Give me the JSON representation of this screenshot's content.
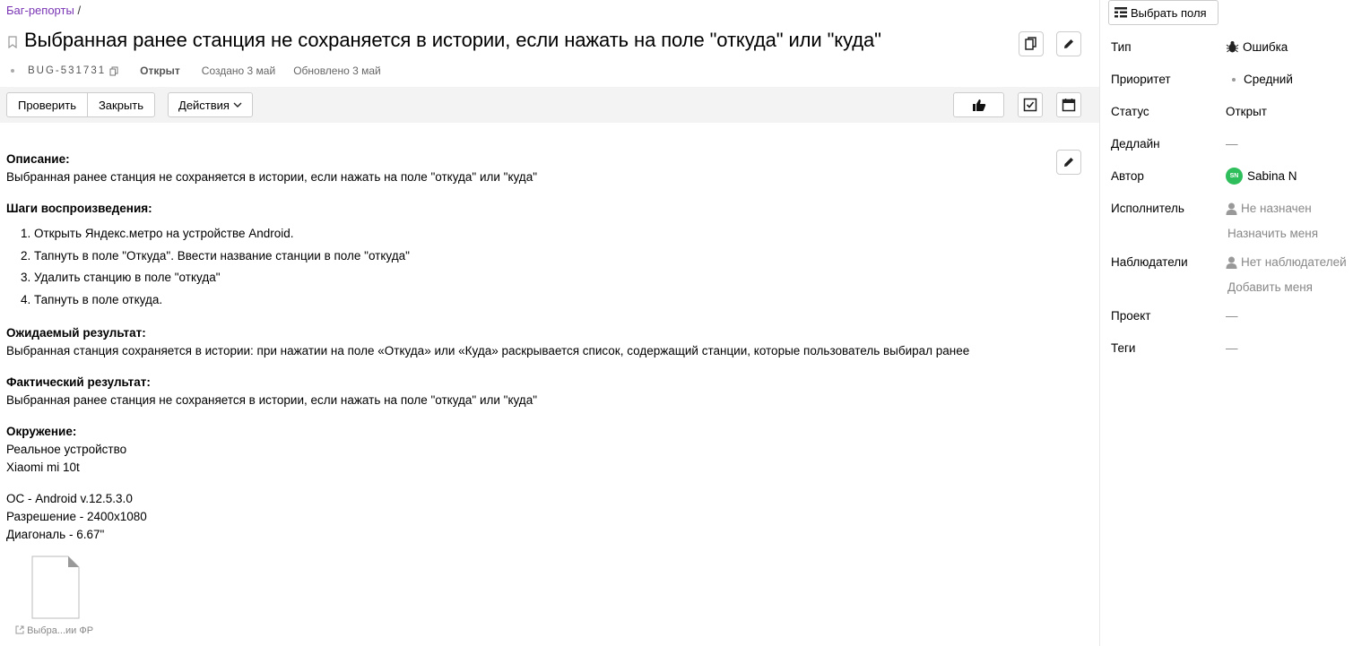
{
  "breadcrumb": {
    "link": "Баг-репорты",
    "sep": "/"
  },
  "issue": {
    "title": "Выбранная ранее станция не сохраняется в истории, если нажать на поле \"откуда\" или \"куда\"",
    "key": "BUG-531731",
    "status": "Открыт",
    "created": "Создано 3 май",
    "updated": "Обновлено 3 май"
  },
  "toolbar": {
    "check_label": "Проверить",
    "close_label": "Закрыть",
    "actions_label": "Действия"
  },
  "description": {
    "desc_heading": "Описание:",
    "desc_text": "Выбранная ранее станция не сохраняется в истории, если нажать на поле \"откуда\" или \"куда\"",
    "steps_heading": "Шаги воспроизведения:",
    "steps": [
      "Открыть Яндекс.метро на устройстве Android.",
      "Тапнуть в поле \"Откуда\". Ввести название станции в поле \"откуда\"",
      "Удалить станцию в поле \"откуда\"",
      "Тапнуть в поле откуда."
    ],
    "expected_heading": "Ожидаемый результат:",
    "expected_text": "Выбранная станция сохраняется в истории: при нажатии на поле «Откуда» или «Куда» раскрывается список, содержащий станции, которые пользователь выбирал ранее",
    "actual_heading": "Фактический результат:",
    "actual_text": "Выбранная ранее станция не сохраняется в истории, если нажать на поле \"откуда\" или \"куда\"",
    "env_heading": "Окружение:",
    "env_lines": [
      "Реальное устройство",
      "Xiaomi mi 10t"
    ],
    "os_lines": [
      "ОС - Android v.12.5.3.0",
      "Разрешение - 2400x1080",
      "Диагональ - 6.67\""
    ]
  },
  "attachment": {
    "label": "Выбра...ии ФР"
  },
  "sidebar": {
    "select_fields_label": "Выбрать поля",
    "fields": {
      "type_label": "Тип",
      "type_value": "Ошибка",
      "priority_label": "Приоритет",
      "priority_value": "Средний",
      "status_label": "Статус",
      "status_value": "Открыт",
      "deadline_label": "Дедлайн",
      "deadline_value": "—",
      "author_label": "Автор",
      "author_initials": "SN",
      "author_value": "Sabina N",
      "assignee_label": "Исполнитель",
      "assignee_value": "Не назначен",
      "assign_me": "Назначить меня",
      "watchers_label": "Наблюдатели",
      "watchers_value": "Нет наблюдателей",
      "add_me": "Добавить меня",
      "project_label": "Проект",
      "project_value": "—",
      "tags_label": "Теги",
      "tags_value": "—"
    }
  },
  "colors": {
    "breadcrumb_link": "#7a35b5",
    "toolbar_bg": "#f3f3f3",
    "avatar_bg": "#2fbe5c"
  }
}
